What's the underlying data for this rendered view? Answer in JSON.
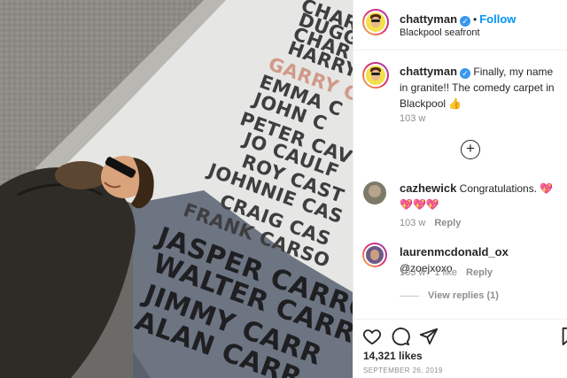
{
  "post": {
    "username": "chattyman",
    "verified_icon": "verified-badge-icon",
    "follow_label": "Follow",
    "separator": "•",
    "location": "Blackpool seafront",
    "caption_text": "Finally, my name in granite!! The comedy carpet in Blackpool",
    "caption_emoji": "👍",
    "caption_time": "103 w",
    "load_more_icon": "plus-circle-icon",
    "likes": "14,321 likes",
    "date": "SEPTEMBER 26, 2019"
  },
  "comments": [
    {
      "username": "cazhewick",
      "text": "Congratulations.",
      "emoji": "💖💖💖💖",
      "time": "103 w",
      "reply_label": "Reply"
    },
    {
      "username": "laurenmcdonald_ox",
      "text": "@zoejxoxo",
      "time": "103 w",
      "likes": "1 like",
      "reply_label": "Reply",
      "view_replies": "View replies (1)"
    }
  ],
  "photo": {
    "names": [
      "CHAR",
      "DUGG",
      "CHAR",
      "HARRY",
      "GARRY C",
      "EMMA C",
      "JOHN C",
      "PETER CAV",
      "JO CAULF",
      "ROY CAST",
      "JOHNNIE CAS",
      "CRAIG CAS",
      "FRANK CARSO",
      "JASPER CARRO",
      "WALTER CARR",
      "JIMMY CARR",
      "ALAN CARR"
    ]
  },
  "icons": {
    "like": "heart-outline-icon",
    "comment": "comment-bubble-icon",
    "share": "paper-plane-icon",
    "save": "bookmark-icon"
  },
  "colors": {
    "accent": "#0095f6",
    "verified": "#3897f0",
    "highlight_name": "#d09a88"
  }
}
